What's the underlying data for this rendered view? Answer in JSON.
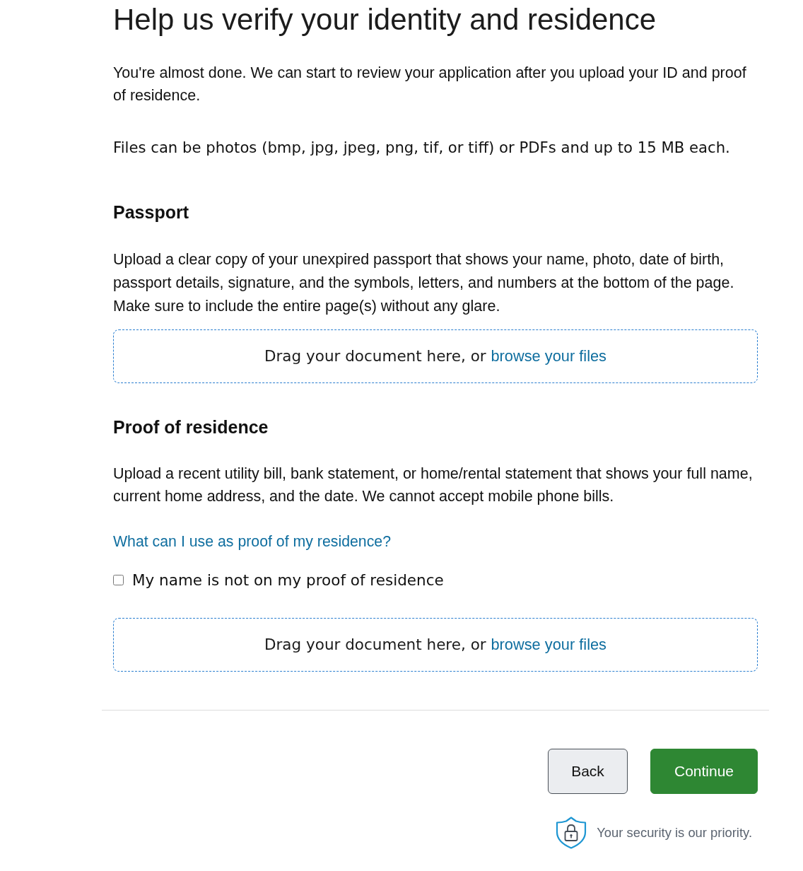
{
  "title": "Help us verify your identity and residence",
  "intro": "You're almost done. We can start to review your application after you upload your ID and proof of residence.",
  "file_note": "Files can be photos (bmp, jpg, jpeg, png, tif, or tiff) or PDFs and up to 15 MB each.",
  "sections": [
    {
      "heading": "Passport",
      "description": "Upload a clear copy of your unexpired passport that shows your name, photo, date of birth, passport details, signature, and the symbols, letters, and numbers at the bottom of the page. Make sure to include the entire page(s) without any glare.",
      "dropzone": {
        "prompt": "Drag your document here, or",
        "link": "browse your files"
      }
    },
    {
      "heading": "Proof of residence",
      "description": "Upload a recent utility bill, bank statement, or home/rental statement that shows your full name, current home address, and the date. We cannot accept mobile phone bills.",
      "help_link": "What can I use as proof of my residence?",
      "checkbox": {
        "label": "My name is not on my proof of residence",
        "checked": false
      },
      "dropzone": {
        "prompt": "Drag your document here, or",
        "link": "browse your files"
      }
    }
  ],
  "buttons": [
    {
      "label": "Back",
      "kind": "secondary"
    },
    {
      "label": "Continue",
      "kind": "primary"
    }
  ],
  "security_note": "Your security is our priority."
}
